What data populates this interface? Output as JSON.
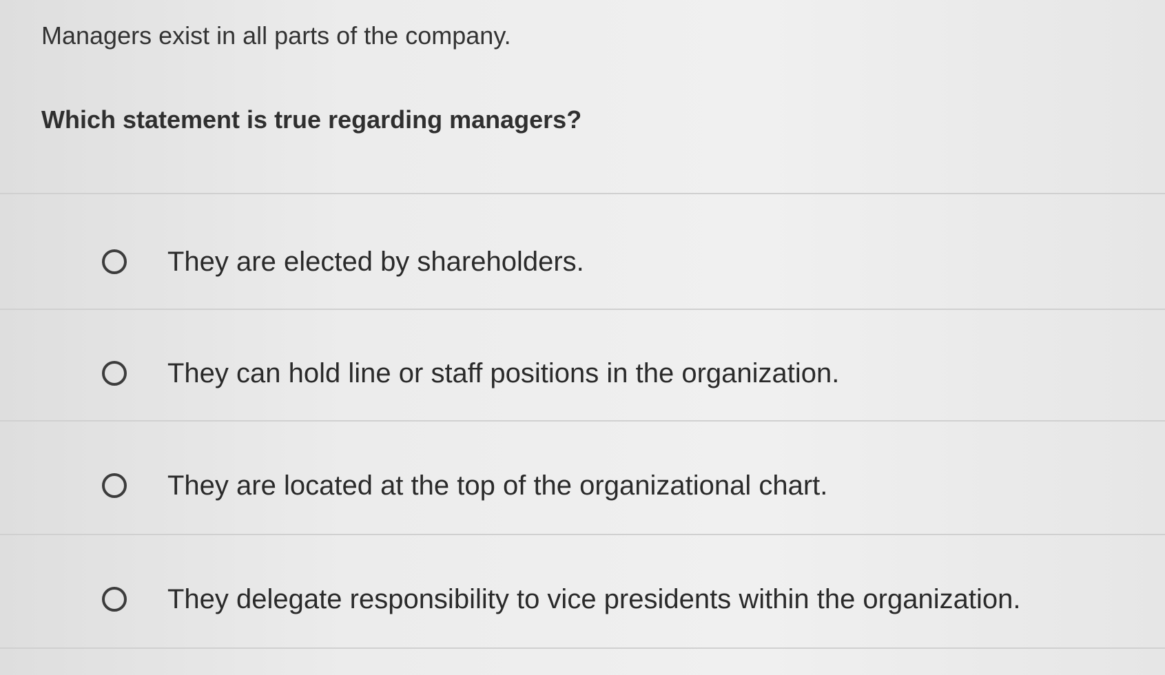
{
  "question": {
    "prompt": "Managers exist in all parts of the company.",
    "text": "Which statement is true regarding managers?"
  },
  "options": [
    {
      "label": "They are elected by shareholders."
    },
    {
      "label": "They can hold line or staff positions in the organization."
    },
    {
      "label": "They are located at the top of the organizational chart."
    },
    {
      "label": "They delegate responsibility to vice presidents within the organization."
    }
  ],
  "colors": {
    "text": "#2a2a2a",
    "radio_border": "#3c3c3c",
    "divider": "#d0d0d0",
    "background": "#ececec"
  },
  "icons": {
    "radio": "radio-button-icon"
  }
}
